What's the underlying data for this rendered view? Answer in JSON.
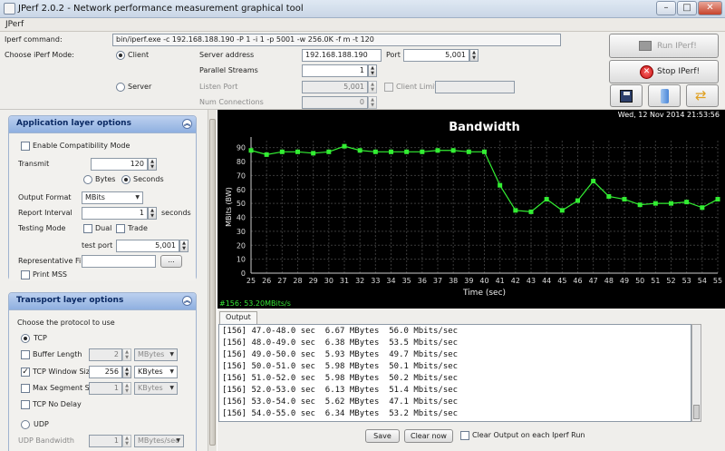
{
  "window": {
    "title": "JPerf 2.0.2 - Network performance measurement graphical tool",
    "minimize": "–",
    "maximize": "□",
    "close": "✕"
  },
  "menu": {
    "label": "JPerf"
  },
  "command": {
    "label": "Iperf command:",
    "value": "bin/iperf.exe -c 192.168.188.190 -P 1 -i 1 -p 5001 -w 256.0K -f m -t 120"
  },
  "mode": {
    "label": "Choose iPerf Mode:",
    "client": "Client",
    "server": "Server",
    "selected": "client"
  },
  "client": {
    "server_address_label": "Server address",
    "server_address": "192.168.188.190",
    "port_label": "Port",
    "port": "5,001",
    "parallel_label": "Parallel Streams",
    "parallel": "1"
  },
  "server": {
    "listen_port_label": "Listen Port",
    "listen_port": "5,001",
    "client_limit_label": "Client Limit",
    "client_limit": "",
    "num_conn_label": "Num Connections",
    "num_conn": "0"
  },
  "buttons": {
    "run": "Run IPerf!",
    "stop": "Stop IPerf!",
    "save_icon": "floppy-save-icon",
    "clear_icon": "broom-icon",
    "refresh_icon": "refresh-arrows-icon"
  },
  "app_layer": {
    "title": "Application layer options",
    "compat": "Enable Compatibility Mode",
    "transmit_label": "Transmit",
    "transmit": "120",
    "bytes": "Bytes",
    "seconds": "Seconds",
    "output_format_label": "Output Format",
    "output_format": "MBits",
    "report_interval_label": "Report Interval",
    "report_interval": "1",
    "seconds_unit": "seconds",
    "testing_mode_label": "Testing Mode",
    "dual": "Dual",
    "trade": "Trade",
    "test_port_label": "test port",
    "test_port": "5,001",
    "rep_file_label": "Representative File",
    "rep_file": "",
    "browse": "...",
    "print_mss": "Print MSS"
  },
  "transport_layer": {
    "title": "Transport layer options",
    "protocol_label": "Choose the protocol to use",
    "tcp": "TCP",
    "buffer_length_label": "Buffer Length",
    "buffer_length": "2",
    "buffer_unit": "MBytes",
    "window_size_label": "TCP Window Size",
    "window_size": "256",
    "window_unit": "KBytes",
    "mss_label": "Max Segment Size",
    "mss": "1",
    "mss_unit": "KBytes",
    "nodelay": "TCP No Delay",
    "udp": "UDP",
    "udp_bw_label": "UDP Bandwidth",
    "udp_bw": "1",
    "udp_bw_unit": "MBytes/sec"
  },
  "chart_data": {
    "type": "line",
    "title": "Bandwidth",
    "xlabel": "Time (sec)",
    "ylabel": "MBits (BW)",
    "date": "Wed, 12 Nov 2014 21:53:56",
    "legend_text": "#156: 53.20MBits/s",
    "series_color": "#33ee33",
    "x": [
      25,
      26,
      27,
      28,
      29,
      30,
      31,
      32,
      33,
      34,
      35,
      36,
      37,
      38,
      39,
      40,
      41,
      42,
      43,
      44,
      45,
      46,
      47,
      48,
      49,
      50,
      51,
      52,
      53,
      54,
      55
    ],
    "y": [
      88,
      85,
      87,
      87,
      86,
      87,
      91,
      88,
      87,
      87,
      87,
      87,
      88,
      88,
      87,
      87,
      63,
      45,
      44,
      53,
      45,
      52,
      66,
      55,
      53,
      49,
      50,
      50,
      51,
      47,
      53
    ],
    "ylim": [
      0,
      95
    ],
    "yticks": [
      0,
      10,
      20,
      30,
      40,
      50,
      60,
      70,
      80,
      90
    ],
    "grid": true
  },
  "output": {
    "tab": "Output",
    "lines": [
      "[156] 47.0-48.0 sec  6.67 MBytes  56.0 Mbits/sec",
      "[156] 48.0-49.0 sec  6.38 MBytes  53.5 Mbits/sec",
      "[156] 49.0-50.0 sec  5.93 MBytes  49.7 Mbits/sec",
      "[156] 50.0-51.0 sec  5.98 MBytes  50.1 Mbits/sec",
      "[156] 51.0-52.0 sec  5.98 MBytes  50.2 Mbits/sec",
      "[156] 52.0-53.0 sec  6.13 MBytes  51.4 Mbits/sec",
      "[156] 53.0-54.0 sec  5.62 MBytes  47.1 Mbits/sec",
      "[156] 54.0-55.0 sec  6.34 MBytes  53.2 Mbits/sec"
    ],
    "save": "Save",
    "clear_now": "Clear now",
    "clear_each": "Clear Output on each Iperf Run"
  }
}
